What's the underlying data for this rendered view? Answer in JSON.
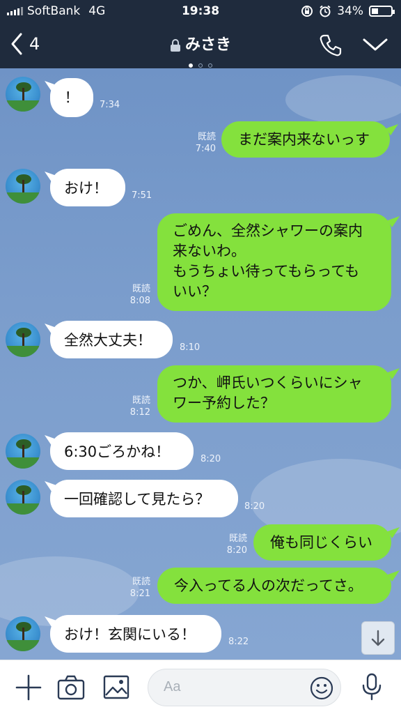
{
  "status": {
    "carrier": "SoftBank",
    "network": "4G",
    "time": "19:38",
    "battery": "34%",
    "battery_level": 0.34
  },
  "header": {
    "back_count": "4",
    "contact": "みさき",
    "page_dots": 3,
    "active_dot": 1
  },
  "messages": [
    {
      "side": "in",
      "lines": [
        "！"
      ],
      "time": "7:34"
    },
    {
      "side": "out",
      "lines": [
        "まだ案内来ないっす"
      ],
      "read": "既読",
      "time": "7:40"
    },
    {
      "side": "in",
      "lines": [
        "おけ！"
      ],
      "time": "7:51"
    },
    {
      "side": "out",
      "lines": [
        "ごめん、全然シャワーの案内",
        "来ないわ。",
        "もうちょい待ってもらっても",
        "いい？"
      ],
      "read": "既読",
      "time": "8:08"
    },
    {
      "side": "in",
      "lines": [
        "全然大丈夫！"
      ],
      "time": "8:10"
    },
    {
      "side": "out",
      "lines": [
        "つか、岬氏いつくらいにシャ",
        "ワー予約した？"
      ],
      "read": "既読",
      "time": "8:12"
    },
    {
      "side": "in",
      "lines": [
        "6:30ごろかね！"
      ],
      "time": "8:20"
    },
    {
      "side": "in",
      "lines": [
        "一回確認して見たら？"
      ],
      "time": "8:20"
    },
    {
      "side": "out",
      "lines": [
        "俺も同じくらい"
      ],
      "read": "既読",
      "time": "8:20"
    },
    {
      "side": "out",
      "lines": [
        "今入ってる人の次だってさ。"
      ],
      "read": "既読",
      "time": "8:21"
    },
    {
      "side": "in",
      "lines": [
        "おけ！玄関にいる！"
      ],
      "time": "8:22"
    }
  ],
  "composer": {
    "placeholder": "Aa"
  },
  "icons": {
    "back": "chevron-left-icon",
    "lock": "lock-icon",
    "call": "phone-icon",
    "menu": "chevron-down-icon",
    "plus": "plus-icon",
    "camera": "camera-icon",
    "image": "image-icon",
    "emoji": "smile-icon",
    "mic": "microphone-icon",
    "scroll": "arrow-down-icon"
  },
  "colors": {
    "header_bg": "#1f2b3d",
    "outgoing_bubble": "#84e13d",
    "incoming_bubble": "#ffffff",
    "chat_bg": "#7b9dcc"
  }
}
